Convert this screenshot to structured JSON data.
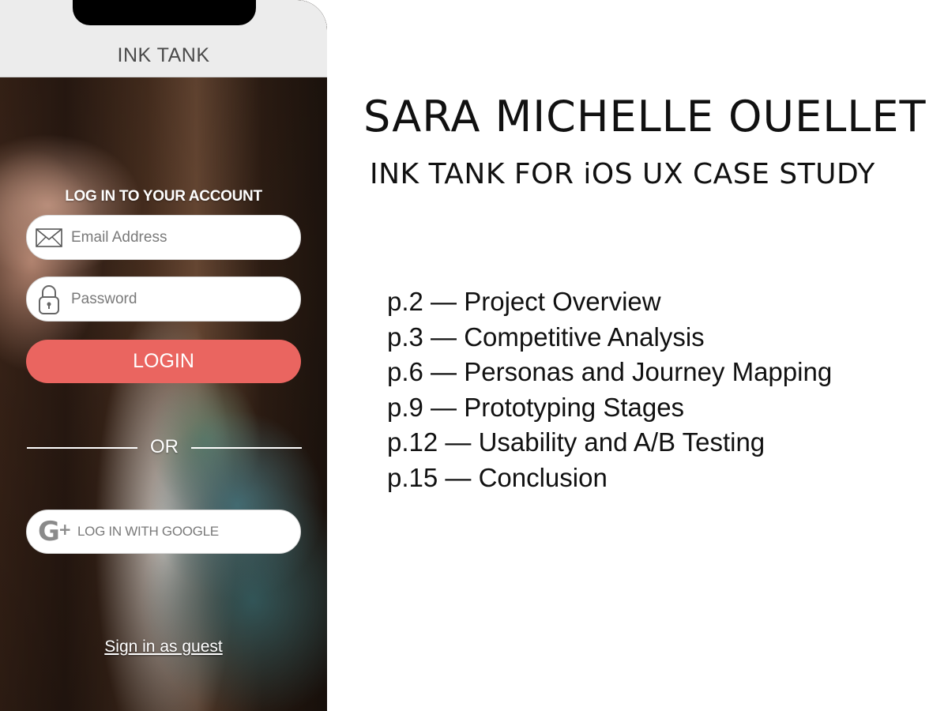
{
  "app": {
    "title": "INK TANK"
  },
  "login": {
    "heading": "LOG IN TO YOUR ACCOUNT",
    "email_placeholder": "Email Address",
    "email_icon": "envelope-icon",
    "password_placeholder": "Password",
    "password_icon": "lock-icon",
    "login_button": "LOGIN",
    "or_text": "OR",
    "google_icon": "google-plus-icon",
    "google_g": "G",
    "google_plus": "+",
    "google_button": "LOG IN WITH GOOGLE",
    "guest_link": "Sign in as guest"
  },
  "colors": {
    "login_button": "#ea6560",
    "topbar": "#ececec"
  },
  "case_study": {
    "author": "SARA MICHELLE OUELLET",
    "subtitle": "INK TANK FOR iOS UX CASE STUDY",
    "toc": [
      {
        "label": "p.2 — Project Overview"
      },
      {
        "label": "p.3 — Competitive Analysis"
      },
      {
        "label": "p.6 — Personas and Journey Mapping"
      },
      {
        "label": "p.9 — Prototyping Stages"
      },
      {
        "label": "p.12 — Usability and A/B Testing"
      },
      {
        "label": "p.15 — Conclusion"
      }
    ]
  }
}
